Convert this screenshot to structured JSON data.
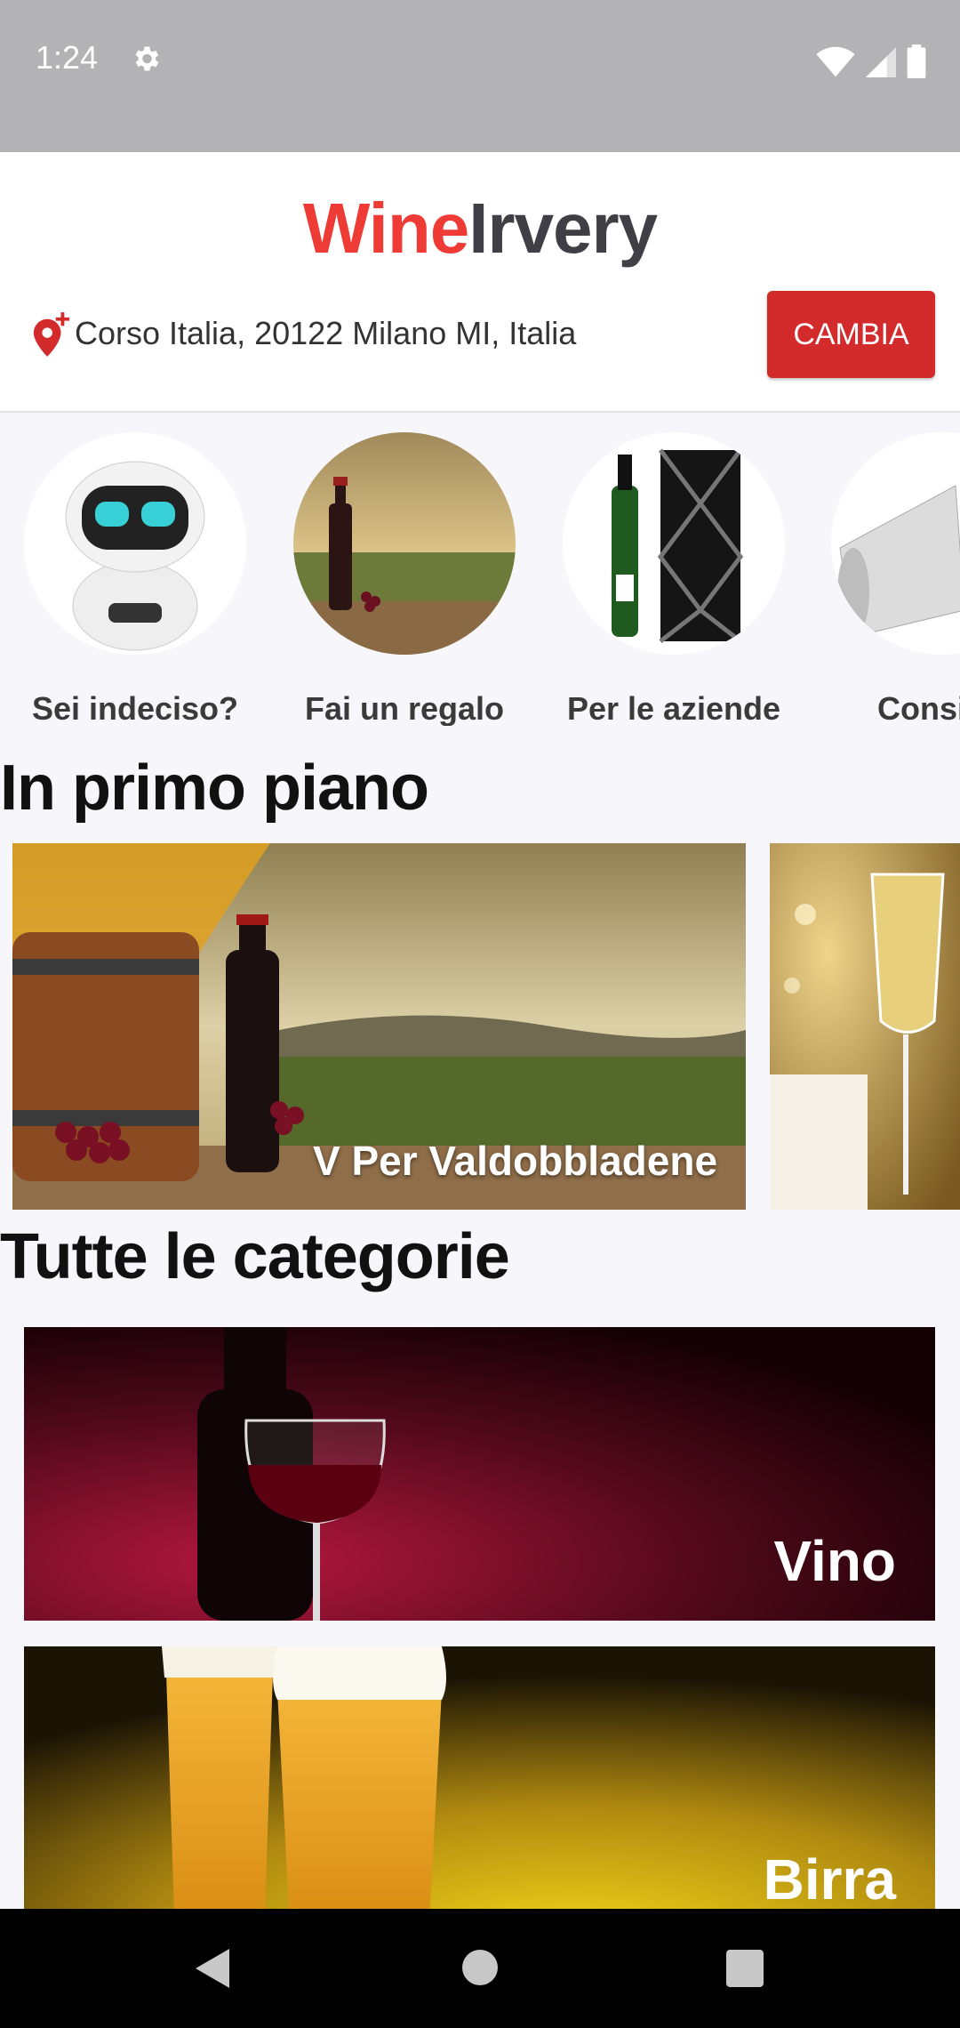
{
  "status_bar": {
    "time": "1:24"
  },
  "header": {
    "logo_part1": "Wine",
    "logo_part2": "Irvery",
    "address": "Corso Italia, 20122 Milano MI, Italia",
    "change_label": "CAMBIA"
  },
  "quick_links": [
    {
      "label": "Sei indeciso?"
    },
    {
      "label": "Fai un regalo"
    },
    {
      "label": "Per le aziende"
    },
    {
      "label": "Consi"
    }
  ],
  "featured": {
    "title": "In primo piano",
    "items": [
      {
        "caption": "V Per Valdobbladene"
      }
    ]
  },
  "categories": {
    "title": "Tutte le categorie",
    "items": [
      {
        "label": "Vino"
      },
      {
        "label": "Birra"
      }
    ]
  },
  "colors": {
    "brand_red": "#ef3b36",
    "button_red": "#d32b2b"
  }
}
